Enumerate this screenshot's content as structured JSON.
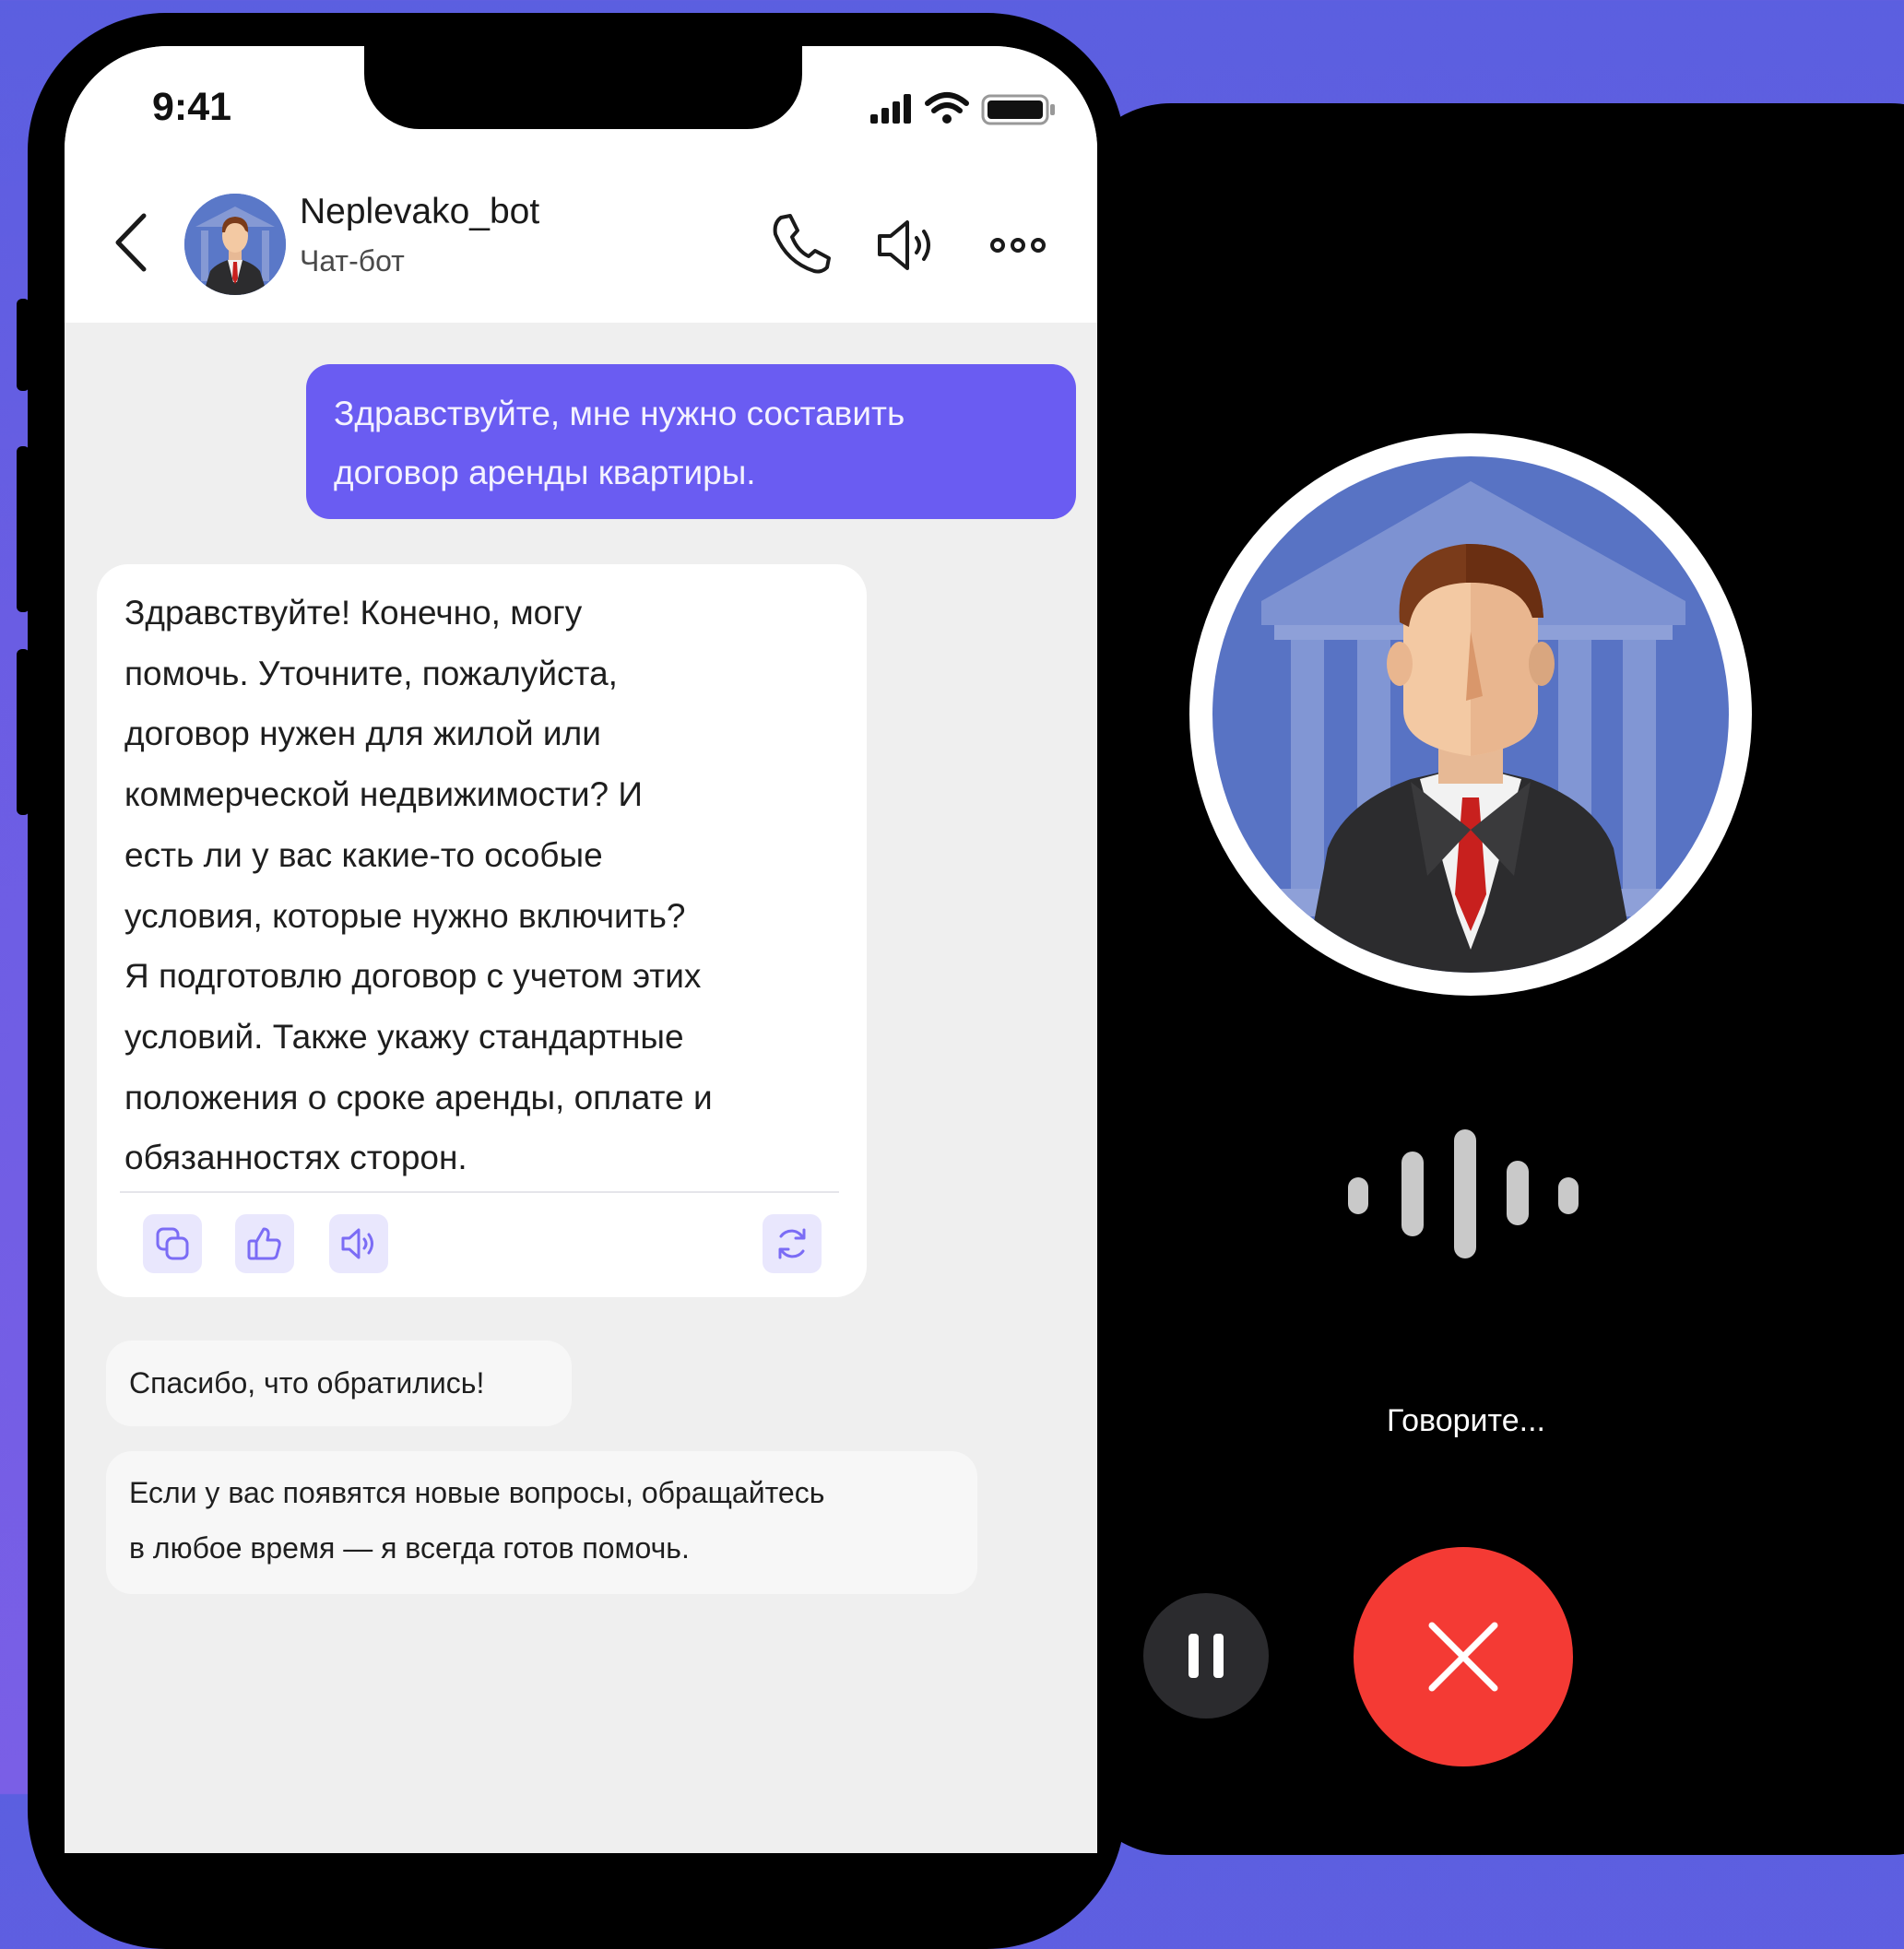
{
  "status_bar": {
    "time": "9:41",
    "icons": [
      "signal-icon",
      "wifi-icon",
      "battery-icon"
    ]
  },
  "chat_header": {
    "bot_name": "Neplevako_bot",
    "subtitle": "Чат-бот",
    "icons": [
      "back-chevron-icon",
      "phone-icon",
      "speaker-icon",
      "more-dots-icon"
    ]
  },
  "messages": {
    "user": [
      "Здравствуйте, мне нужно составить",
      "договор аренды квартиры."
    ],
    "bot_reply": [
      "Здравствуйте! Конечно, могу",
      "помочь. Уточните, пожалуйста,",
      "договор нужен для жилой или",
      "коммерческой недвижимости? И",
      "есть ли у вас какие-то особые",
      "условия, которые нужно включить?",
      "Я подготовлю договор с учетом этих",
      "условий. Также укажу стандартные",
      "положения о сроке аренды, оплате и",
      "обязанностях сторон."
    ],
    "bot_actions": [
      "copy-icon",
      "thumbs-up-icon",
      "speaker-icon",
      "refresh-icon"
    ],
    "thanks": "Спасибо, что обратились!",
    "more": [
      "Если у вас появятся новые вопросы, обращайтесь",
      "в любое время — я всегда готов помочь."
    ]
  },
  "call_screen": {
    "status": "Говорите...",
    "controls": [
      "pause-icon",
      "close-icon"
    ]
  },
  "colors": {
    "background": "#6a5de3",
    "user_bubble": "#6a5cf2",
    "accent_icon": "#7b6cf5",
    "end_call": "#f43a34",
    "call_bg": "#000000"
  }
}
